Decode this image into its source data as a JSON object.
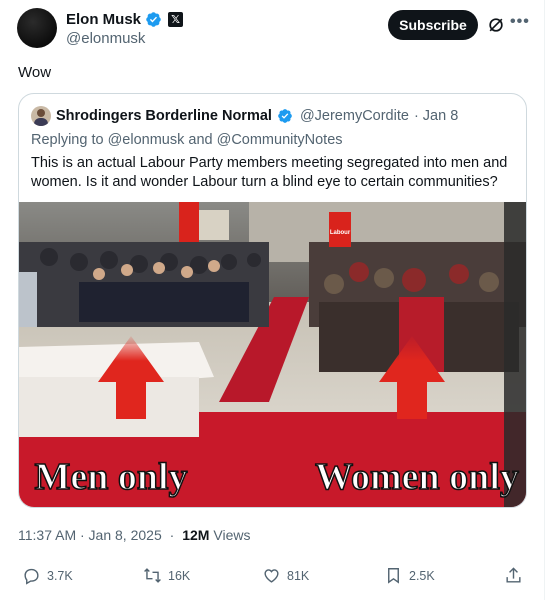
{
  "post": {
    "author_name": "Elon Musk",
    "author_handle": "@elonmusk",
    "subscribe_label": "Subscribe",
    "more_label": "•••",
    "text": "Wow",
    "timestamp": "11:37 AM · Jan 8, 2025",
    "views_separator": " · ",
    "views_count": "12M",
    "views_label": "Views"
  },
  "quote": {
    "author_name": "Shrodingers Borderline Normal",
    "author_handle": "@JeremyCordite",
    "date": "· Jan 8",
    "replying_to": "Replying to @elonmusk and @CommunityNotes",
    "text": "This is an actual Labour Party members meeting segregated into men and women. Is it and wonder Labour turn a blind eye to certain communities?",
    "image": {
      "left_caption": "Men only",
      "right_caption": "Women only",
      "banner_text": "Labour"
    }
  },
  "actions": {
    "replies": "3.7K",
    "reposts": "16K",
    "likes": "81K",
    "bookmarks": "2.5K"
  },
  "colors": {
    "verified": "#1d9bf0",
    "text_primary": "#0f1419",
    "text_secondary": "#536471",
    "arrow_red": "#d9231c",
    "carpet_red": "#c8192a"
  },
  "icons": [
    "verified-badge-icon",
    "x-logo-icon",
    "grok-icon",
    "more-icon",
    "reply-icon",
    "repost-icon",
    "like-icon",
    "bookmark-icon",
    "share-icon"
  ]
}
